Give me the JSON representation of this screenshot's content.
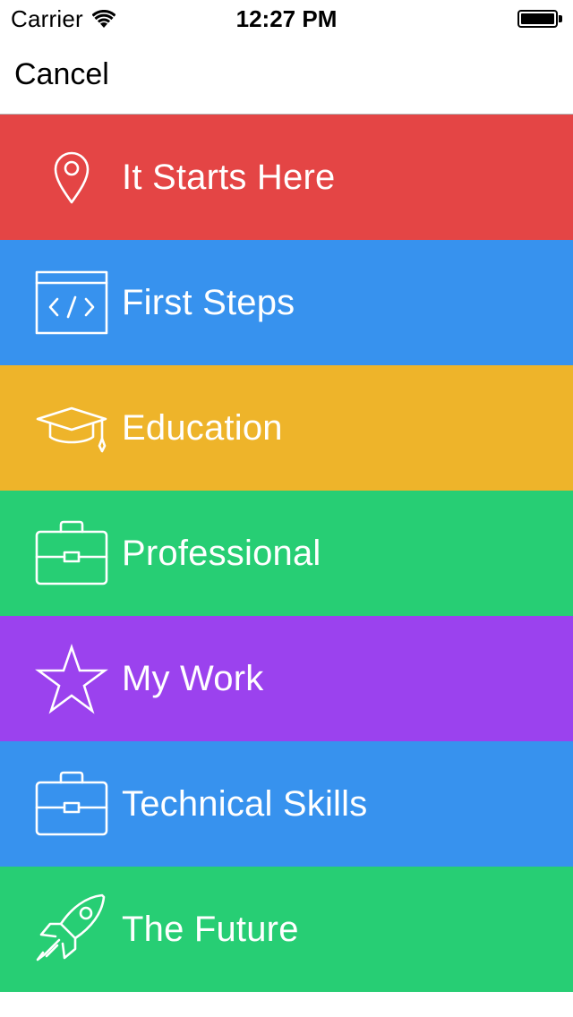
{
  "status_bar": {
    "carrier": "Carrier",
    "time": "12:27 PM",
    "wifi_icon": "wifi-icon",
    "battery_icon": "battery-icon"
  },
  "nav": {
    "cancel_label": "Cancel"
  },
  "menu": {
    "items": [
      {
        "label": "It Starts Here",
        "icon": "map-pin-icon",
        "color": "#E44545"
      },
      {
        "label": "First Steps",
        "icon": "code-window-icon",
        "color": "#3792EE"
      },
      {
        "label": "Education",
        "icon": "graduation-cap-icon",
        "color": "#EEB42A"
      },
      {
        "label": "Professional",
        "icon": "briefcase-icon",
        "color": "#27CE74"
      },
      {
        "label": "My Work",
        "icon": "star-icon",
        "color": "#9B42EE"
      },
      {
        "label": "Technical Skills",
        "icon": "briefcase-icon",
        "color": "#3792EE"
      },
      {
        "label": "The Future",
        "icon": "rocket-icon",
        "color": "#27CE74"
      }
    ]
  }
}
